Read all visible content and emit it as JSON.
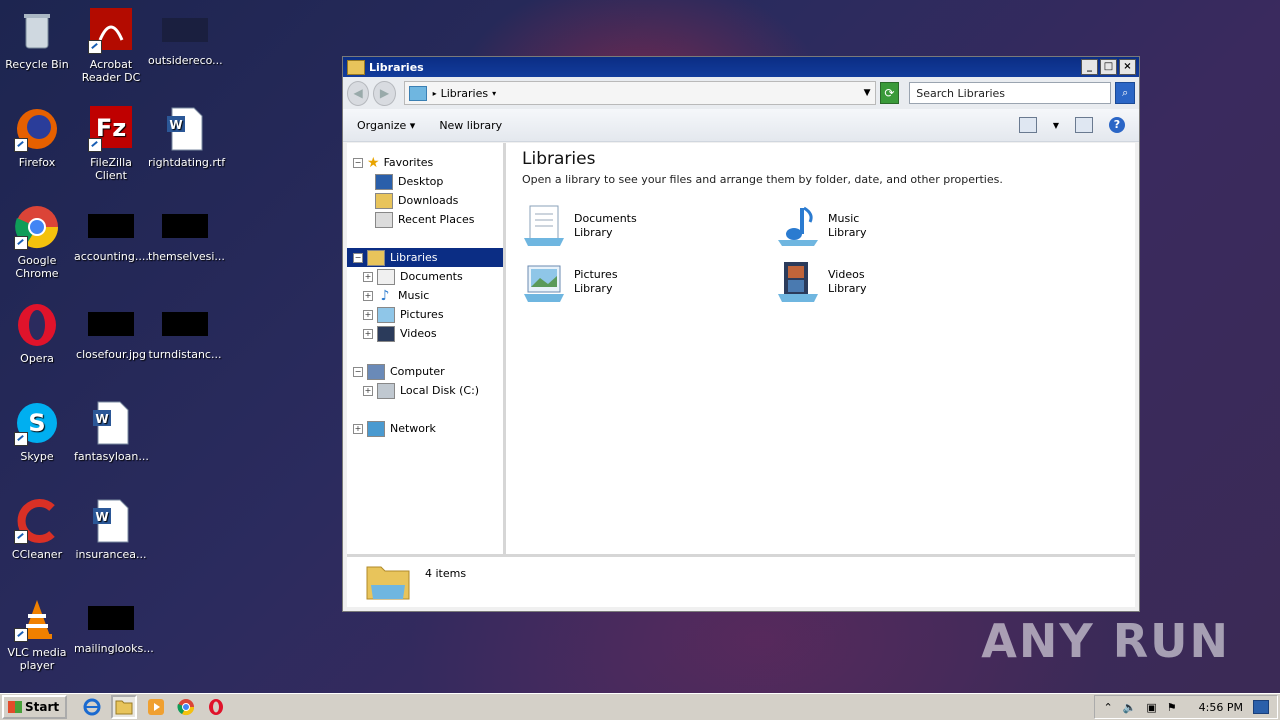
{
  "desktop": {
    "icons": [
      {
        "label": "Recycle Bin"
      },
      {
        "label": "Acrobat Reader DC"
      },
      {
        "label": "outsidereco..."
      },
      {
        "label": "Firefox"
      },
      {
        "label": "FileZilla Client"
      },
      {
        "label": "rightdating.rtf"
      },
      {
        "label": "Google Chrome"
      },
      {
        "label": "accounting...."
      },
      {
        "label": "themselvesi..."
      },
      {
        "label": "Opera"
      },
      {
        "label": "closefour.jpg"
      },
      {
        "label": "turndistanc..."
      },
      {
        "label": "Skype"
      },
      {
        "label": "fantasyloan..."
      },
      {
        "label": "CCleaner"
      },
      {
        "label": "insurancea..."
      },
      {
        "label": "VLC media player"
      },
      {
        "label": "mailinglooks..."
      }
    ]
  },
  "window": {
    "title": "Libraries",
    "address": "Libraries",
    "search_placeholder": "Search Libraries",
    "commands": {
      "organize": "Organize",
      "new_library": "New library"
    },
    "nav": {
      "favorites": "Favorites",
      "desktop": "Desktop",
      "downloads": "Downloads",
      "recent": "Recent Places",
      "libraries": "Libraries",
      "documents": "Documents",
      "music": "Music",
      "pictures": "Pictures",
      "videos": "Videos",
      "computer": "Computer",
      "local_disk": "Local Disk (C:)",
      "network": "Network"
    },
    "content": {
      "heading": "Libraries",
      "description": "Open a library to see your files and arrange them by folder, date, and other properties.",
      "libraries": [
        {
          "name": "Documents",
          "type": "Library"
        },
        {
          "name": "Music",
          "type": "Library"
        },
        {
          "name": "Pictures",
          "type": "Library"
        },
        {
          "name": "Videos",
          "type": "Library"
        }
      ]
    },
    "status": "4 items"
  },
  "taskbar": {
    "start": "Start",
    "clock": "4:56 PM"
  },
  "watermark": "ANY RUN"
}
